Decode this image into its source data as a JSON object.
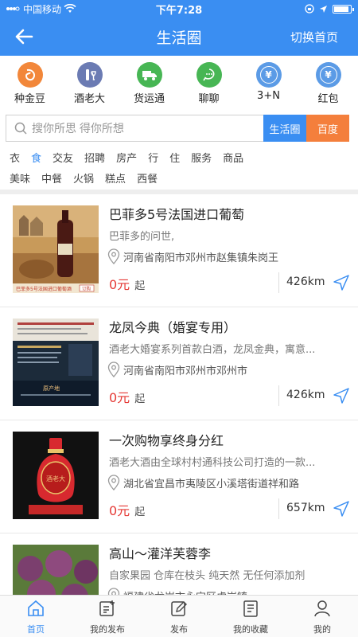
{
  "status_bar": {
    "carrier": "中国移动",
    "time": "下午7:28"
  },
  "nav": {
    "title": "生活圈",
    "switch_label": "切换首页"
  },
  "quick_links": [
    {
      "label": "种金豆",
      "icon": "bean-icon",
      "color": "#f2873a",
      "glyph": ""
    },
    {
      "label": "酒老大",
      "icon": "wine-icon",
      "color": "#6b7bb3",
      "glyph": ""
    },
    {
      "label": "货运通",
      "icon": "truck-icon",
      "color": "#47b654",
      "glyph": ""
    },
    {
      "label": "聊聊",
      "icon": "chat-icon",
      "color": "#47b654",
      "glyph": ""
    },
    {
      "label": "3+N",
      "icon": "yuan-icon",
      "color": "#5b9be6",
      "glyph": "¥"
    },
    {
      "label": "红包",
      "icon": "redpacket-icon",
      "color": "#5b9be6",
      "glyph": "¥"
    }
  ],
  "search": {
    "placeholder": "搜你所思 得你所想",
    "btn_life": "生活圈",
    "btn_baidu": "百度"
  },
  "categories_row1": [
    "衣",
    "食",
    "交友",
    "招聘",
    "房产",
    "行",
    "住",
    "服务",
    "商品"
  ],
  "categories_row2": [
    "美味",
    "中餐",
    "火锅",
    "糕点",
    "西餐"
  ],
  "active_category": "食",
  "listings": [
    {
      "title": "巴菲多5号法国进口葡萄",
      "desc": "巴菲多的问世,",
      "address": "河南省南阳市邓州市赵集镇朱岗王",
      "price": "0元",
      "price_unit": "起",
      "distance": "426km",
      "thumb_caption": "巴菲多5号法国进口葡萄酒",
      "thumb_tag": "订购"
    },
    {
      "title": "龙凤今典（婚宴专用）",
      "desc": "酒老大婚宴系列首款白酒，龙凤金典，寓意...",
      "address": "河南省南阳市邓州市邓州市",
      "price": "0元",
      "price_unit": "起",
      "distance": "426km",
      "thumb_caption": "原产地"
    },
    {
      "title": "一次购物享终身分红",
      "desc": "酒老大酒由全球村村通科技公司打造的一款...",
      "address": "湖北省宜昌市夷陵区小溪塔街道祥和路",
      "price": "0元",
      "price_unit": "起",
      "distance": "657km",
      "thumb_caption": "酒老大"
    },
    {
      "title": "高山～灌洋芙蓉李",
      "desc": "自家果园  仓库在枝头  纯天然  无任何添加剂",
      "address": "福建省龙岩市永定区虎岗镇",
      "price": "",
      "price_unit": "",
      "distance": ""
    }
  ],
  "tabbar": [
    {
      "label": "首页",
      "icon": "home-icon"
    },
    {
      "label": "我的发布",
      "icon": "my-posts-icon"
    },
    {
      "label": "发布",
      "icon": "publish-icon"
    },
    {
      "label": "我的收藏",
      "icon": "favorites-icon"
    },
    {
      "label": "我的",
      "icon": "profile-icon"
    }
  ],
  "active_tab": "首页"
}
